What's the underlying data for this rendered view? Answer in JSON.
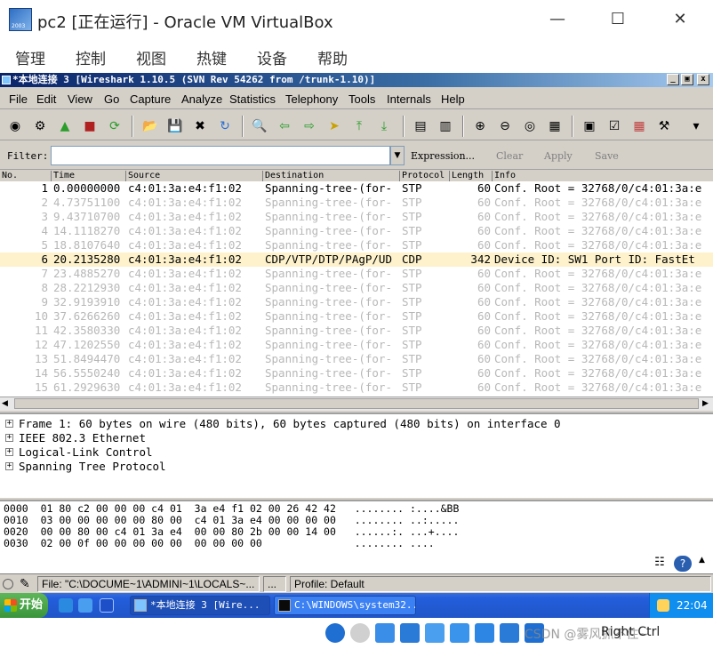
{
  "host": {
    "title": "pc2 [正在运行] - Oracle VM VirtualBox",
    "logo_text": "2003",
    "menu": [
      "管理",
      "控制",
      "视图",
      "热键",
      "设备",
      "帮助"
    ],
    "host_key": "Right Ctrl",
    "watermark": "CSDN @雾风抓不住~"
  },
  "ws": {
    "title": "*本地连接 3   [Wireshark 1.10.5  (SVN Rev 54262 from /trunk-1.10)]",
    "menu": [
      "File",
      "Edit",
      "View",
      "Go",
      "Capture",
      "Analyze",
      "Statistics",
      "Telephony",
      "Tools",
      "Internals",
      "Help"
    ],
    "filter": {
      "label": "Filter:",
      "value": "",
      "expression": "Expression...",
      "clear": "Clear",
      "apply": "Apply",
      "save": "Save"
    },
    "columns": [
      "No.",
      "Time",
      "Source",
      "Destination",
      "Protocol",
      "Length",
      "Info"
    ],
    "packets": [
      {
        "no": "1",
        "time": "0.00000000",
        "src": "c4:01:3a:e4:f1:02",
        "dst": "Spanning-tree-(for-",
        "proto": "STP",
        "len": "60",
        "info": "Conf. Root = 32768/0/c4:01:3a:e",
        "state": "sel"
      },
      {
        "no": "2",
        "time": "4.73751100",
        "src": "c4:01:3a:e4:f1:02",
        "dst": "Spanning-tree-(for-",
        "proto": "STP",
        "len": "60",
        "info": "Conf. Root = 32768/0/c4:01:3a:e",
        "state": ""
      },
      {
        "no": "3",
        "time": "9.43710700",
        "src": "c4:01:3a:e4:f1:02",
        "dst": "Spanning-tree-(for-",
        "proto": "STP",
        "len": "60",
        "info": "Conf. Root = 32768/0/c4:01:3a:e",
        "state": ""
      },
      {
        "no": "4",
        "time": "14.1118270",
        "src": "c4:01:3a:e4:f1:02",
        "dst": "Spanning-tree-(for-",
        "proto": "STP",
        "len": "60",
        "info": "Conf. Root = 32768/0/c4:01:3a:e",
        "state": ""
      },
      {
        "no": "5",
        "time": "18.8107640",
        "src": "c4:01:3a:e4:f1:02",
        "dst": "Spanning-tree-(for-",
        "proto": "STP",
        "len": "60",
        "info": "Conf. Root = 32768/0/c4:01:3a:e",
        "state": ""
      },
      {
        "no": "6",
        "time": "20.2135280",
        "src": "c4:01:3a:e4:f1:02",
        "dst": "CDP/VTP/DTP/PAgP/UD",
        "proto": "CDP",
        "len": "342",
        "info": "Device ID: SW1  Port ID: FastEt",
        "state": "cdp"
      },
      {
        "no": "7",
        "time": "23.4885270",
        "src": "c4:01:3a:e4:f1:02",
        "dst": "Spanning-tree-(for-",
        "proto": "STP",
        "len": "60",
        "info": "Conf. Root = 32768/0/c4:01:3a:e",
        "state": ""
      },
      {
        "no": "8",
        "time": "28.2212930",
        "src": "c4:01:3a:e4:f1:02",
        "dst": "Spanning-tree-(for-",
        "proto": "STP",
        "len": "60",
        "info": "Conf. Root = 32768/0/c4:01:3a:e",
        "state": ""
      },
      {
        "no": "9",
        "time": "32.9193910",
        "src": "c4:01:3a:e4:f1:02",
        "dst": "Spanning-tree-(for-",
        "proto": "STP",
        "len": "60",
        "info": "Conf. Root = 32768/0/c4:01:3a:e",
        "state": ""
      },
      {
        "no": "10",
        "time": "37.6266260",
        "src": "c4:01:3a:e4:f1:02",
        "dst": "Spanning-tree-(for-",
        "proto": "STP",
        "len": "60",
        "info": "Conf. Root = 32768/0/c4:01:3a:e",
        "state": ""
      },
      {
        "no": "11",
        "time": "42.3580330",
        "src": "c4:01:3a:e4:f1:02",
        "dst": "Spanning-tree-(for-",
        "proto": "STP",
        "len": "60",
        "info": "Conf. Root = 32768/0/c4:01:3a:e",
        "state": ""
      },
      {
        "no": "12",
        "time": "47.1202550",
        "src": "c4:01:3a:e4:f1:02",
        "dst": "Spanning-tree-(for-",
        "proto": "STP",
        "len": "60",
        "info": "Conf. Root = 32768/0/c4:01:3a:e",
        "state": ""
      },
      {
        "no": "13",
        "time": "51.8494470",
        "src": "c4:01:3a:e4:f1:02",
        "dst": "Spanning-tree-(for-",
        "proto": "STP",
        "len": "60",
        "info": "Conf. Root = 32768/0/c4:01:3a:e",
        "state": ""
      },
      {
        "no": "14",
        "time": "56.5550240",
        "src": "c4:01:3a:e4:f1:02",
        "dst": "Spanning-tree-(for-",
        "proto": "STP",
        "len": "60",
        "info": "Conf. Root = 32768/0/c4:01:3a:e",
        "state": ""
      },
      {
        "no": "15",
        "time": "61.2929630",
        "src": "c4:01:3a:e4:f1:02",
        "dst": "Spanning-tree-(for-",
        "proto": "STP",
        "len": "60",
        "info": "Conf. Root = 32768/0/c4:01:3a:e",
        "state": ""
      }
    ],
    "details": [
      "Frame 1: 60 bytes on wire (480 bits), 60 bytes captured (480 bits) on interface 0",
      "IEEE 802.3 Ethernet",
      "Logical-Link Control",
      "Spanning Tree Protocol"
    ],
    "bytes": [
      {
        "off": "0000",
        "hex": "01 80 c2 00 00 00 c4 01  3a e4 f1 02 00 26 42 42",
        "ascii": "........ :....&BB"
      },
      {
        "off": "0010",
        "hex": "03 00 00 00 00 00 80 00  c4 01 3a e4 00 00 00 00",
        "ascii": "........ ..:....."
      },
      {
        "off": "0020",
        "hex": "00 00 80 00 c4 01 3a e4  00 00 80 2b 00 00 14 00",
        "ascii": "......:. ...+...."
      },
      {
        "off": "0030",
        "hex": "02 00 0f 00 00 00 00 00  00 00 00 00",
        "ascii": "........ ...."
      }
    ],
    "status": {
      "file": "File: \"C:\\DOCUME~1\\ADMINI~1\\LOCALS~...",
      "dots": "...",
      "profile": "Profile: Default"
    }
  },
  "taskbar": {
    "start": "开始",
    "tasks": [
      "*本地连接 3   [Wire...",
      "C:\\WINDOWS\\system32..."
    ],
    "clock": "22:04"
  }
}
